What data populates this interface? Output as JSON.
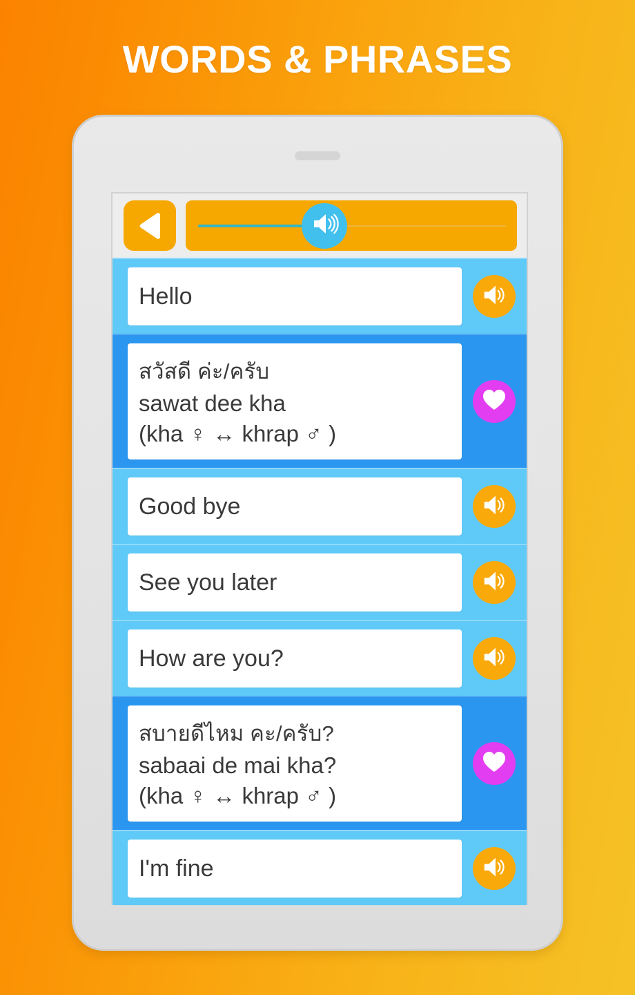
{
  "header": {
    "title": "WORDS & PHRASES"
  },
  "colors": {
    "background_left": "#FB8200",
    "background_right": "#F5C226",
    "device_body": "#E4E4E4",
    "toolbar_bg": "#EDEDED",
    "accent_orange": "#F7A800",
    "speaker_button": "#FAA90A",
    "heart_button": "#E23DF0",
    "row_english": "#5FC9F8",
    "row_thai": "#2B96F0",
    "slider_thumb": "#41C0EE",
    "slider_fill": "#35B6C4",
    "card_text": "#3A3A3A"
  },
  "toolbar": {
    "back_icon": "back-triangle-icon",
    "volume_icon": "speaker-icon",
    "slider_value": 45
  },
  "rows": [
    {
      "type": "english",
      "lines": [
        "Hello"
      ],
      "action": "speaker",
      "action_icon": "speaker-icon"
    },
    {
      "type": "thai",
      "lines": [
        "สวัสดี ค่ะ/ครับ",
        "sawat dee kha",
        "(kha ♀ ↔ khrap ♂ )"
      ],
      "action": "favorite",
      "action_icon": "heart-icon"
    },
    {
      "type": "english",
      "lines": [
        "Good bye"
      ],
      "action": "speaker",
      "action_icon": "speaker-icon"
    },
    {
      "type": "english",
      "lines": [
        "See you later"
      ],
      "action": "speaker",
      "action_icon": "speaker-icon"
    },
    {
      "type": "english",
      "lines": [
        "How are you?"
      ],
      "action": "speaker",
      "action_icon": "speaker-icon"
    },
    {
      "type": "thai",
      "lines": [
        "สบายดีไหม คะ/ครับ?",
        "sabaai de mai kha?",
        "(kha ♀ ↔ khrap ♂ )"
      ],
      "action": "favorite",
      "action_icon": "heart-icon"
    },
    {
      "type": "english",
      "lines": [
        "I'm fine"
      ],
      "action": "speaker",
      "action_icon": "speaker-icon"
    }
  ]
}
